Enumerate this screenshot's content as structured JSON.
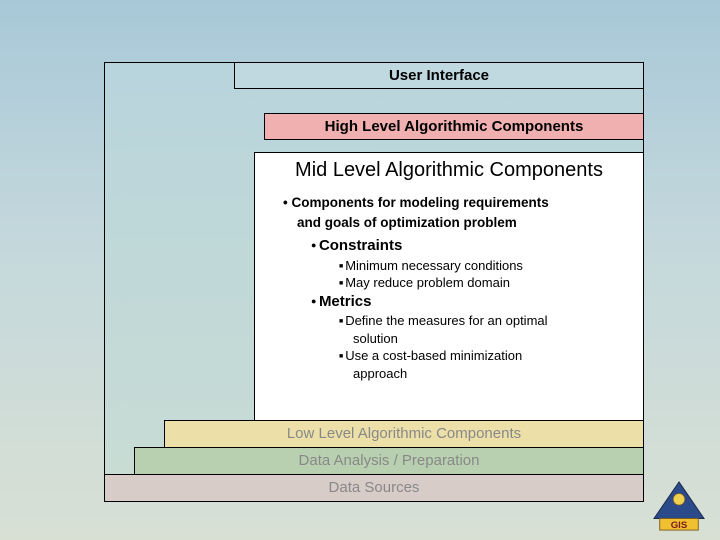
{
  "layers": {
    "ui": "User Interface",
    "high": "High Level Algorithmic Components",
    "mid": "Mid Level Algorithmic Components",
    "low": "Low Level Algorithmic Components",
    "dataprep": "Data Analysis / Preparation",
    "datasources": "Data Sources"
  },
  "mid_content": {
    "bullet1_line1": "Components for modeling requirements",
    "bullet1_line2": "and goals of optimization problem",
    "sub1": "Constraints",
    "sub1_a": "Minimum necessary conditions",
    "sub1_b": "May reduce problem domain",
    "sub2": "Metrics",
    "sub2_a_line1": "Define the measures for an optimal",
    "sub2_a_line2": "solution",
    "sub2_b_line1": "Use a cost-based minimization",
    "sub2_b_line2": "approach"
  },
  "logo_text": "GIS"
}
